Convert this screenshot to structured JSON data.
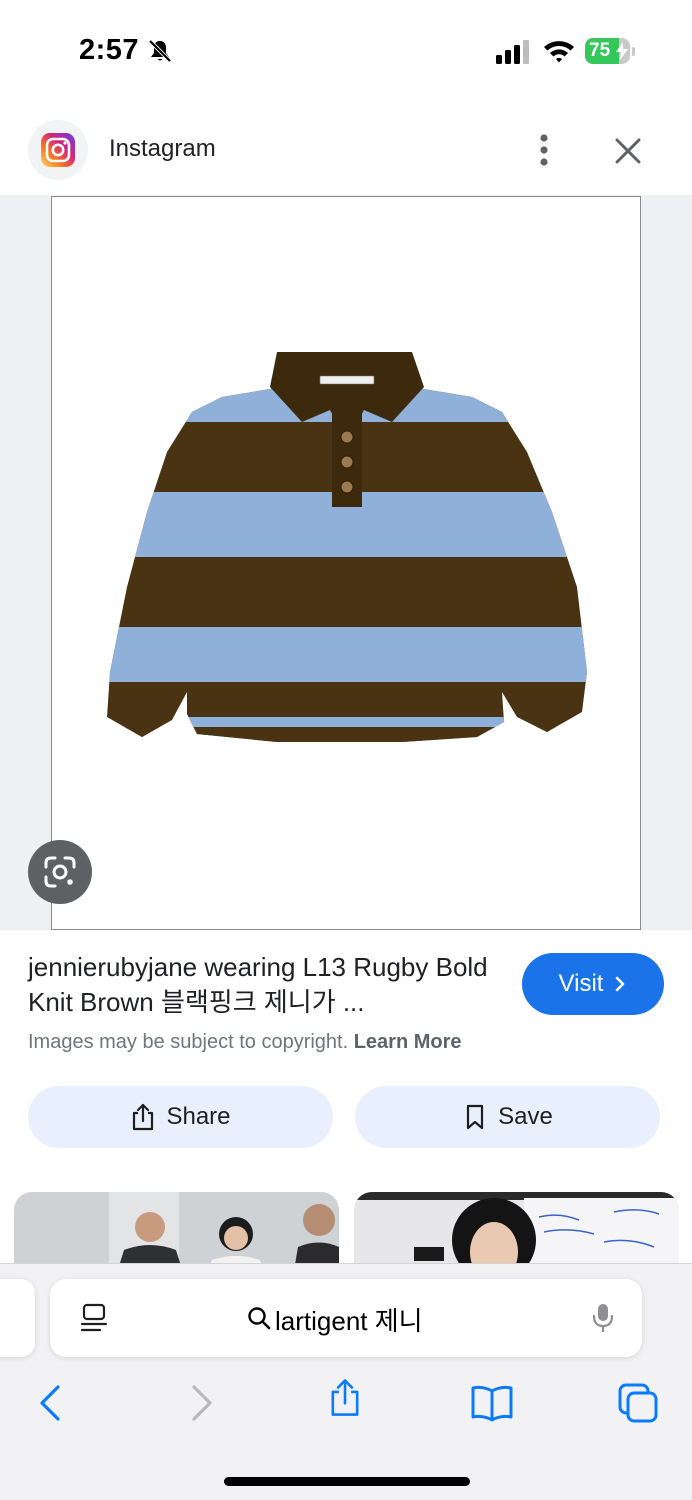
{
  "status_bar": {
    "time": "2:57",
    "battery_percent": "75",
    "battery_level": 0.75,
    "icons": [
      "bell-slash-icon",
      "cellular-signal-icon",
      "wifi-icon",
      "battery-charging-icon"
    ]
  },
  "source": {
    "name": "Instagram",
    "logo_icon": "instagram-icon",
    "actions": [
      "more-vertical-icon",
      "close-icon"
    ]
  },
  "image_viewer": {
    "lens_icon": "google-lens-icon"
  },
  "result": {
    "title": "jennierubyjane wearing L13 Rugby Bold Knit Brown 블랙핑크 제니가 ...",
    "visit_label": "Visit",
    "copyright_text": "Images may be subject to copyright.",
    "learn_more_label": "Learn More"
  },
  "actions": {
    "share_label": "Share",
    "save_label": "Save"
  },
  "browser": {
    "url_text": "lartigent 제니",
    "icons": [
      "reader-mode-icon",
      "search-icon",
      "microphone-icon",
      "back-icon",
      "forward-icon",
      "share-icon",
      "bookmarks-icon",
      "tabs-icon"
    ]
  },
  "colors": {
    "accent": "#1a73e8",
    "chip_background": "#e8f0fe",
    "sweater_brown": "#4a3312",
    "sweater_blue": "#8fb0d8",
    "ios_blue": "#0a7aff",
    "battery_green": "#35c759"
  }
}
